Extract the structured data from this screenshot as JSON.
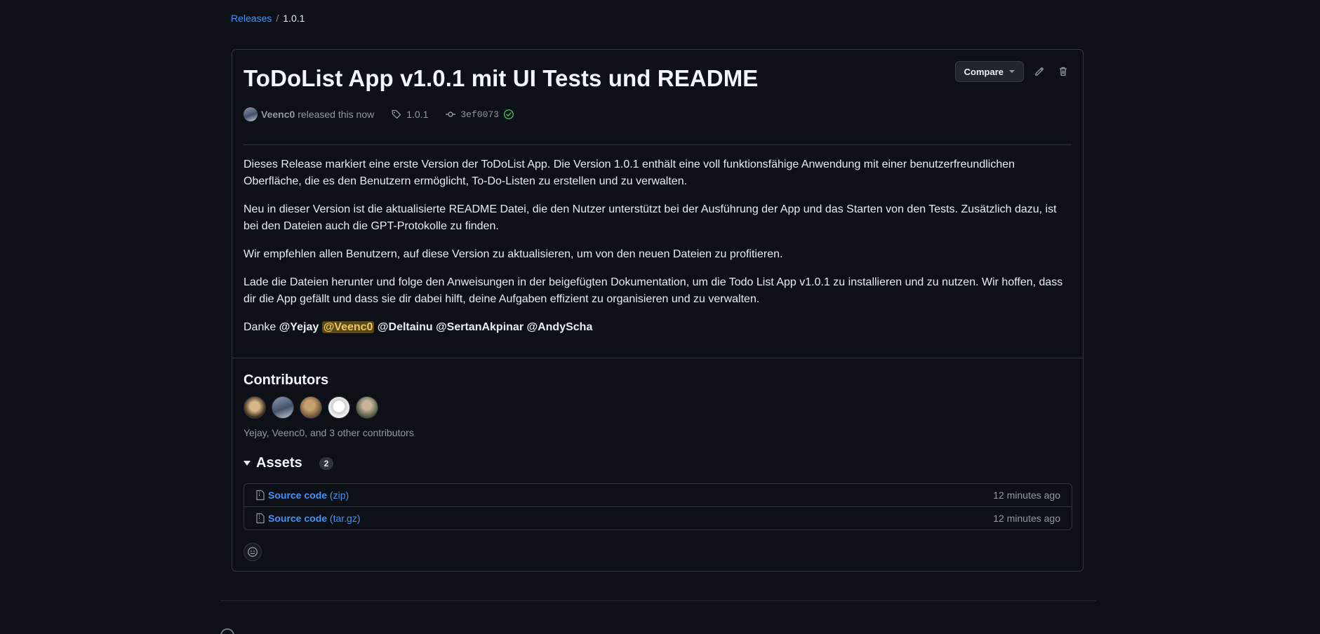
{
  "breadcrumb": {
    "releases_label": "Releases",
    "separator": "/",
    "current": "1.0.1"
  },
  "release": {
    "title": "ToDoList App v1.0.1 mit UI Tests und README",
    "author": "Veenc0",
    "released_text": "released this now",
    "tag": "1.0.1",
    "commit": "3ef0073",
    "compare_label": "Compare",
    "verified_icon": "check-circle-icon",
    "paragraphs": [
      "Dieses Release markiert eine erste Version der ToDoList App. Die Version 1.0.1 enthält eine voll funktionsfähige Anwendung mit einer benutzerfreundlichen Oberfläche, die es den Benutzern ermöglicht, To-Do-Listen zu erstellen und zu verwalten.",
      "Neu in dieser Version ist die aktualisierte README Datei, die den Nutzer unterstützt bei der Ausführung der App und das Starten von den Tests. Zusätzlich dazu, ist bei den Dateien auch die GPT-Protokolle zu finden.",
      "Wir empfehlen allen Benutzern, auf diese Version zu aktualisieren, um von den neuen Dateien zu profitieren.",
      "Lade die Dateien herunter und folge den Anweisungen in der beigefügten Dokumentation, um die Todo List App v1.0.1 zu installieren und zu nutzen. Wir hoffen, dass dir die App gefällt und dass sie dir dabei hilft, deine Aufgaben effizient zu organisieren und zu verwalten."
    ],
    "thanks_prefix": "Danke",
    "mentions": [
      "@Yejay",
      "@Veenc0",
      "@Deltainu",
      "@SertanAkpinar",
      "@AndyScha"
    ]
  },
  "contributors": {
    "title": "Contributors",
    "summary": "Yejay, Veenc0, and 3 other contributors"
  },
  "assets": {
    "title": "Assets",
    "count": "2",
    "items": [
      {
        "name": "Source code",
        "suffix": "(zip)",
        "time": "12 minutes ago"
      },
      {
        "name": "Source code",
        "suffix": "(tar.gz)",
        "time": "12 minutes ago"
      }
    ]
  },
  "colors": {
    "background": "#0d1117",
    "link": "#4493f8",
    "border": "#30363d",
    "muted": "#9198a1",
    "success": "#3fb950"
  }
}
